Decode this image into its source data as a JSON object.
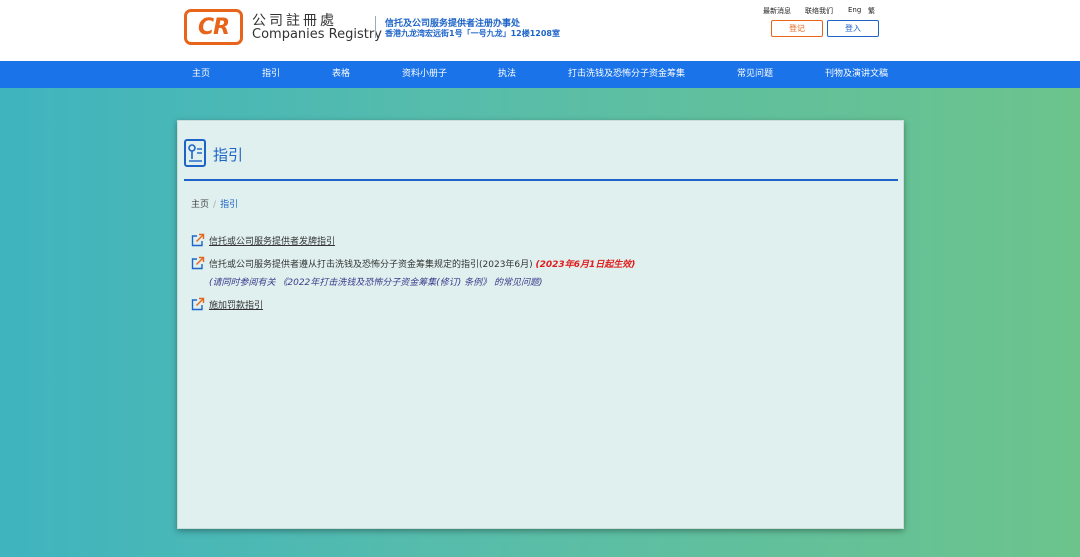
{
  "header": {
    "logo_text": "CR",
    "brand_cn": "公司註冊處",
    "brand_en": "Companies Registry",
    "office_name": "信托及公司服务提供者注册办事处",
    "office_address": "香港九龙湾宏远街1号「一号九龙」12楼1208室",
    "top_links": [
      "最新消息",
      "联络我们",
      "Eng",
      "繁"
    ],
    "register_label": "登记",
    "login_label": "登入"
  },
  "nav": {
    "items": [
      "主页",
      "指引",
      "表格",
      "资料小册子",
      "执法",
      "打击洗钱及恐怖分子资金筹集",
      "常见问题",
      "刊物及演讲文稿"
    ]
  },
  "page": {
    "title": "指引",
    "breadcrumb": {
      "home": "主页",
      "separator": "/",
      "current": "指引"
    },
    "links": [
      {
        "text": "信托或公司服务提供者发牌指引"
      },
      {
        "text": "信托或公司服务提供者遵从打击洗钱及恐怖分子资金筹集规定的指引(2023年6月)",
        "effective": "(2023年6月1日起生效)",
        "note": "(请同时参阅有关 《2022年打击洗钱及恐怖分子资金筹集(修订) 条例》 的常见问题)"
      },
      {
        "text": "施加罚款指引"
      }
    ]
  },
  "colors": {
    "brand_orange": "#e8641b",
    "brand_blue": "#1e64c8",
    "nav_blue": "#1a73e8",
    "effective_red": "#e01e1e"
  },
  "icons": [
    "guide-book-icon",
    "external-link-icon"
  ]
}
